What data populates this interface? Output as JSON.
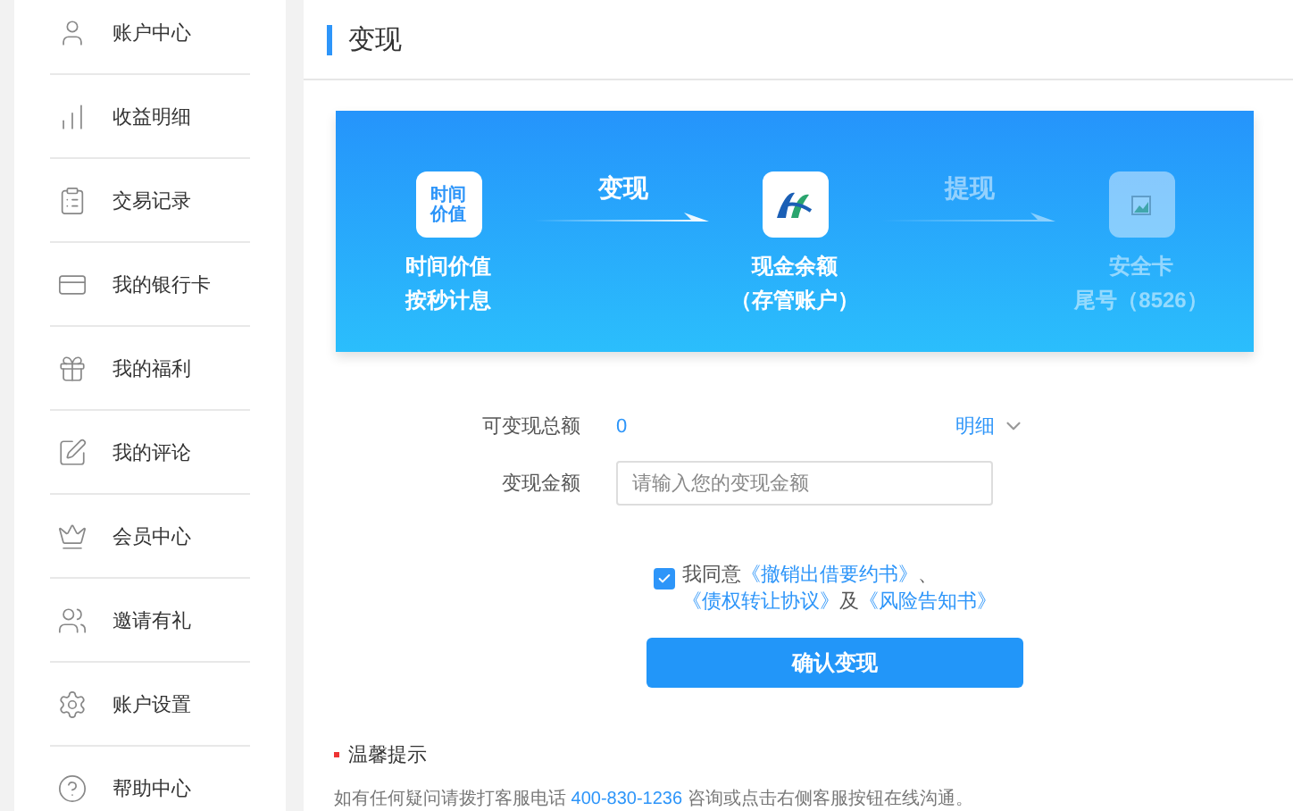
{
  "sidebar": {
    "items": [
      {
        "label": "账户中心",
        "selected": false
      },
      {
        "label": "收益明细",
        "selected": false
      },
      {
        "label": "交易记录",
        "selected": false
      },
      {
        "label": "我的银行卡",
        "selected": false
      },
      {
        "label": "我的福利",
        "selected": false
      },
      {
        "label": "我的评论",
        "selected": false
      },
      {
        "label": "会员中心",
        "selected": false
      },
      {
        "label": "邀请有礼",
        "selected": false
      },
      {
        "label": "账户设置",
        "selected": false
      },
      {
        "label": "帮助中心",
        "selected": false
      }
    ]
  },
  "page": {
    "title": "变现"
  },
  "banner": {
    "flow": [
      {
        "kind": "step",
        "icon_lines": [
          "时间",
          "价值"
        ],
        "lines": [
          "时间价值",
          "按秒计息"
        ],
        "faded": false
      },
      {
        "kind": "arrow",
        "label": "变现",
        "faded": false
      },
      {
        "kind": "step",
        "lines": [
          "现金余额",
          "（存管账户）"
        ],
        "faded": false
      },
      {
        "kind": "arrow",
        "label": "提现",
        "faded": true
      },
      {
        "kind": "step",
        "lines": [
          "安全卡",
          "尾号（8526）"
        ],
        "faded": true
      }
    ]
  },
  "form": {
    "total": {
      "label": "可变现总额",
      "value": "0",
      "detail": "明细"
    },
    "amount": {
      "label": "变现金额",
      "placeholder": "请输入您的变现金额"
    },
    "agreement": {
      "checked": true,
      "prefix": "我同意",
      "links": [
        {
          "text": "《撤销出借要约书》",
          "separator": "、"
        },
        {
          "text": "《债权转让协议》",
          "separator": "及"
        },
        {
          "text": "《风险告知书》"
        }
      ]
    },
    "submit": "确认变现"
  },
  "tips": {
    "title": "温馨提示",
    "segments": [
      {
        "kind": "text",
        "text": "如有任何疑问请拨打客服电话 "
      },
      {
        "kind": "link",
        "text": "400-830-1236"
      },
      {
        "kind": "text",
        "text": " 咨询或点击右侧客服按钮在线沟通。"
      }
    ]
  }
}
